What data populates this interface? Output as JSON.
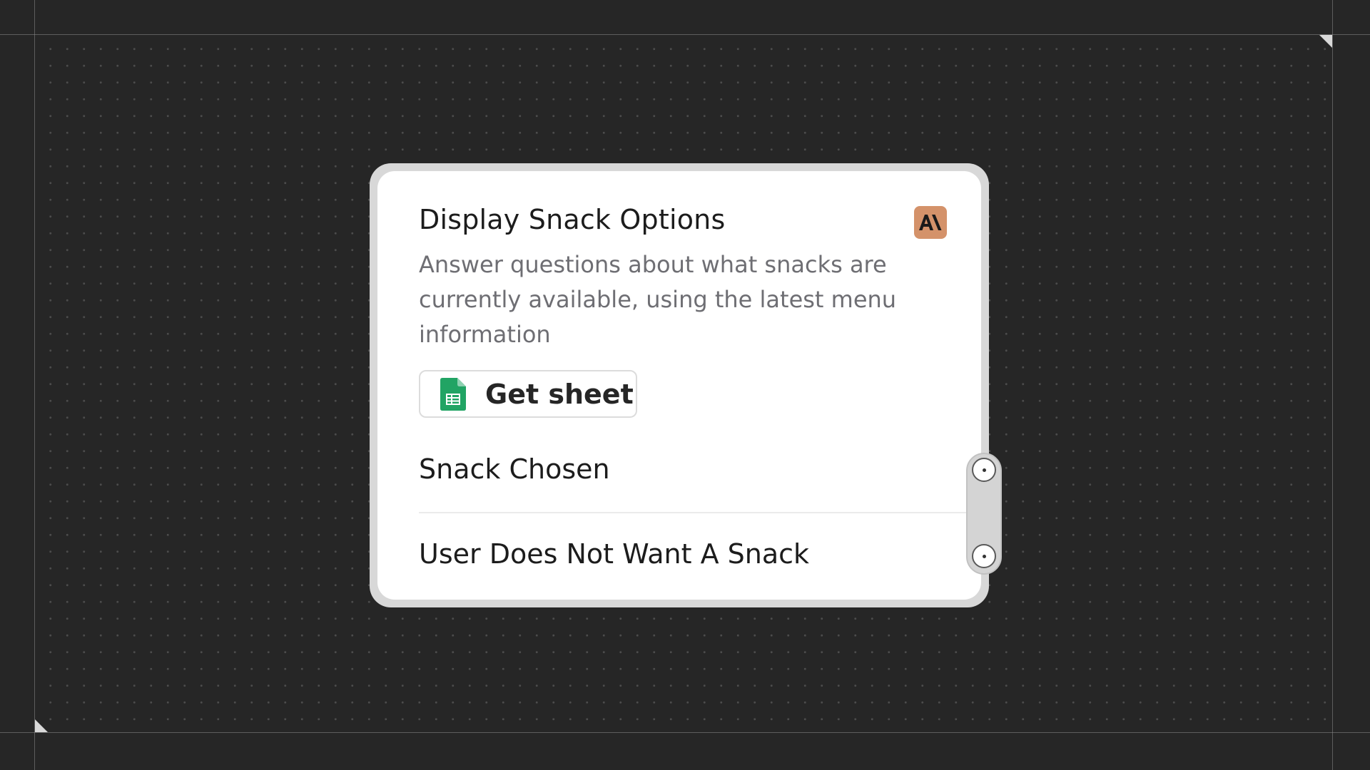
{
  "node": {
    "title": "Display Snack Options",
    "description": "Answer questions about what snacks are currently available, using the latest menu information",
    "model_badge": {
      "text": "A\\",
      "icon": "anthropic-logo-icon",
      "color": "#d4926a"
    },
    "tool": {
      "label": "Get sheet",
      "icon": "google-sheets-icon",
      "icon_color": "#21a464"
    },
    "outputs": [
      {
        "label": "Snack Chosen",
        "port_icon": "output-port-icon"
      },
      {
        "label": "User Does Not Want A Snack",
        "port_icon": "output-port-icon"
      }
    ]
  },
  "colors": {
    "background": "#262626",
    "canvas_dots": "#4c4c4c",
    "card_border": "#d8d8d8",
    "card": "#ffffff",
    "title_text": "#1c1c1c",
    "description_text": "#6e6e73"
  }
}
